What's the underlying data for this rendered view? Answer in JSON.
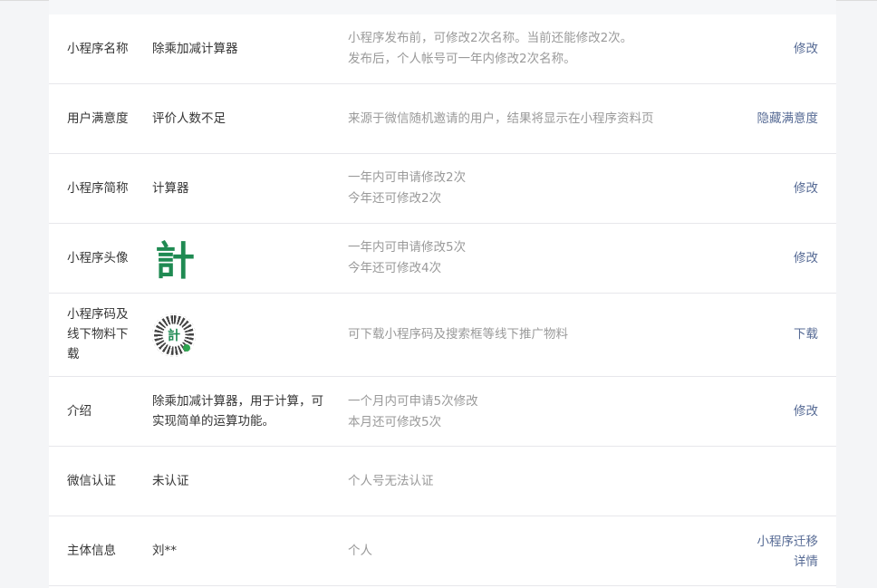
{
  "rows": {
    "name": {
      "label": "小程序名称",
      "value": "除乘加减计算器",
      "desc1": "小程序发布前，可修改2次名称。当前还能修改2次。",
      "desc2": "发布后，个人帐号可一年内修改2次名称。",
      "action": "修改"
    },
    "satisfaction": {
      "label": "用户满意度",
      "value": "评价人数不足",
      "desc1": "来源于微信随机邀请的用户，结果将显示在小程序资料页",
      "action": "隐藏满意度"
    },
    "short_name": {
      "label": "小程序简称",
      "value": "计算器",
      "desc1": "一年内可申请修改2次",
      "desc2": "今年还可修改2次",
      "action": "修改"
    },
    "avatar": {
      "label": "小程序头像",
      "glyph": "計",
      "desc1": "一年内可申请修改5次",
      "desc2": "今年还可修改4次",
      "action": "修改"
    },
    "qrcode": {
      "label1": "小程序码及",
      "label2": "线下物料下",
      "label3": "载",
      "glyph": "計",
      "desc1": "可下载小程序码及搜索框等线下推广物料",
      "action": "下载"
    },
    "intro": {
      "label": "介绍",
      "value1": "除乘加减计算器，用于计算，可",
      "value2": "实现简单的运算功能。",
      "desc1": "一个月内可申请5次修改",
      "desc2": "本月还可修改5次",
      "action": "修改"
    },
    "wechat_auth": {
      "label": "微信认证",
      "value": "未认证",
      "desc1": "个人号无法认证"
    },
    "entity": {
      "label": "主体信息",
      "value": "刘**",
      "desc1": "个人",
      "action1": "小程序迁移",
      "action2": "详情"
    }
  }
}
